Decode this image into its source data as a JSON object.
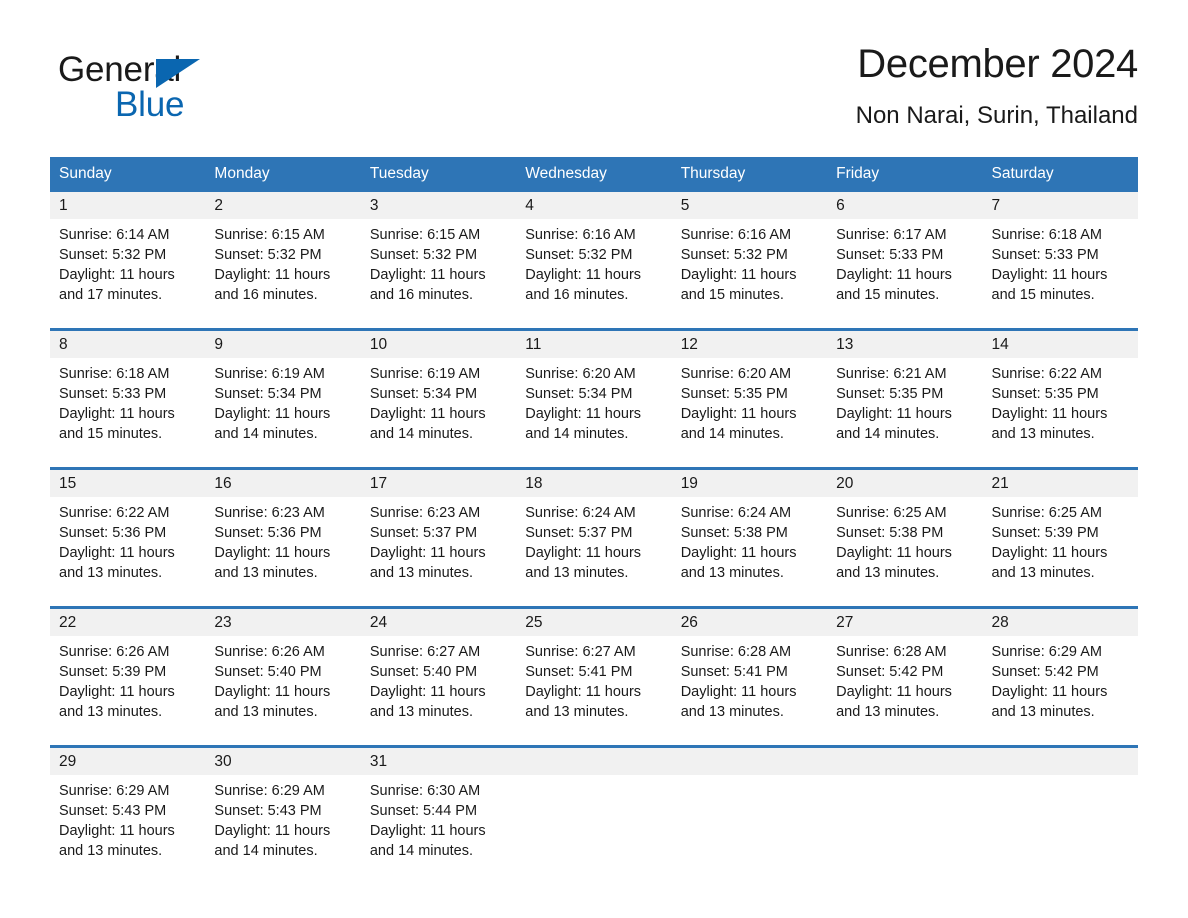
{
  "brand": {
    "logo_text_top": "General",
    "logo_text_bottom": "Blue",
    "triangle_color": "#0a66b0"
  },
  "header": {
    "title": "December 2024",
    "subtitle": "Non Narai, Surin, Thailand"
  },
  "theme": {
    "header_blue": "#2e75b6",
    "daynum_band": "#f1f1f1",
    "text": "#1a1a1a",
    "page_bg": "#ffffff"
  },
  "weekday_headers": [
    "Sunday",
    "Monday",
    "Tuesday",
    "Wednesday",
    "Thursday",
    "Friday",
    "Saturday"
  ],
  "weeks": [
    {
      "days": [
        {
          "num": "1",
          "sunrise": "Sunrise: 6:14 AM",
          "sunset": "Sunset: 5:32 PM",
          "daylight_1": "Daylight: 11 hours",
          "daylight_2": "and 17 minutes."
        },
        {
          "num": "2",
          "sunrise": "Sunrise: 6:15 AM",
          "sunset": "Sunset: 5:32 PM",
          "daylight_1": "Daylight: 11 hours",
          "daylight_2": "and 16 minutes."
        },
        {
          "num": "3",
          "sunrise": "Sunrise: 6:15 AM",
          "sunset": "Sunset: 5:32 PM",
          "daylight_1": "Daylight: 11 hours",
          "daylight_2": "and 16 minutes."
        },
        {
          "num": "4",
          "sunrise": "Sunrise: 6:16 AM",
          "sunset": "Sunset: 5:32 PM",
          "daylight_1": "Daylight: 11 hours",
          "daylight_2": "and 16 minutes."
        },
        {
          "num": "5",
          "sunrise": "Sunrise: 6:16 AM",
          "sunset": "Sunset: 5:32 PM",
          "daylight_1": "Daylight: 11 hours",
          "daylight_2": "and 15 minutes."
        },
        {
          "num": "6",
          "sunrise": "Sunrise: 6:17 AM",
          "sunset": "Sunset: 5:33 PM",
          "daylight_1": "Daylight: 11 hours",
          "daylight_2": "and 15 minutes."
        },
        {
          "num": "7",
          "sunrise": "Sunrise: 6:18 AM",
          "sunset": "Sunset: 5:33 PM",
          "daylight_1": "Daylight: 11 hours",
          "daylight_2": "and 15 minutes."
        }
      ]
    },
    {
      "days": [
        {
          "num": "8",
          "sunrise": "Sunrise: 6:18 AM",
          "sunset": "Sunset: 5:33 PM",
          "daylight_1": "Daylight: 11 hours",
          "daylight_2": "and 15 minutes."
        },
        {
          "num": "9",
          "sunrise": "Sunrise: 6:19 AM",
          "sunset": "Sunset: 5:34 PM",
          "daylight_1": "Daylight: 11 hours",
          "daylight_2": "and 14 minutes."
        },
        {
          "num": "10",
          "sunrise": "Sunrise: 6:19 AM",
          "sunset": "Sunset: 5:34 PM",
          "daylight_1": "Daylight: 11 hours",
          "daylight_2": "and 14 minutes."
        },
        {
          "num": "11",
          "sunrise": "Sunrise: 6:20 AM",
          "sunset": "Sunset: 5:34 PM",
          "daylight_1": "Daylight: 11 hours",
          "daylight_2": "and 14 minutes."
        },
        {
          "num": "12",
          "sunrise": "Sunrise: 6:20 AM",
          "sunset": "Sunset: 5:35 PM",
          "daylight_1": "Daylight: 11 hours",
          "daylight_2": "and 14 minutes."
        },
        {
          "num": "13",
          "sunrise": "Sunrise: 6:21 AM",
          "sunset": "Sunset: 5:35 PM",
          "daylight_1": "Daylight: 11 hours",
          "daylight_2": "and 14 minutes."
        },
        {
          "num": "14",
          "sunrise": "Sunrise: 6:22 AM",
          "sunset": "Sunset: 5:35 PM",
          "daylight_1": "Daylight: 11 hours",
          "daylight_2": "and 13 minutes."
        }
      ]
    },
    {
      "days": [
        {
          "num": "15",
          "sunrise": "Sunrise: 6:22 AM",
          "sunset": "Sunset: 5:36 PM",
          "daylight_1": "Daylight: 11 hours",
          "daylight_2": "and 13 minutes."
        },
        {
          "num": "16",
          "sunrise": "Sunrise: 6:23 AM",
          "sunset": "Sunset: 5:36 PM",
          "daylight_1": "Daylight: 11 hours",
          "daylight_2": "and 13 minutes."
        },
        {
          "num": "17",
          "sunrise": "Sunrise: 6:23 AM",
          "sunset": "Sunset: 5:37 PM",
          "daylight_1": "Daylight: 11 hours",
          "daylight_2": "and 13 minutes."
        },
        {
          "num": "18",
          "sunrise": "Sunrise: 6:24 AM",
          "sunset": "Sunset: 5:37 PM",
          "daylight_1": "Daylight: 11 hours",
          "daylight_2": "and 13 minutes."
        },
        {
          "num": "19",
          "sunrise": "Sunrise: 6:24 AM",
          "sunset": "Sunset: 5:38 PM",
          "daylight_1": "Daylight: 11 hours",
          "daylight_2": "and 13 minutes."
        },
        {
          "num": "20",
          "sunrise": "Sunrise: 6:25 AM",
          "sunset": "Sunset: 5:38 PM",
          "daylight_1": "Daylight: 11 hours",
          "daylight_2": "and 13 minutes."
        },
        {
          "num": "21",
          "sunrise": "Sunrise: 6:25 AM",
          "sunset": "Sunset: 5:39 PM",
          "daylight_1": "Daylight: 11 hours",
          "daylight_2": "and 13 minutes."
        }
      ]
    },
    {
      "days": [
        {
          "num": "22",
          "sunrise": "Sunrise: 6:26 AM",
          "sunset": "Sunset: 5:39 PM",
          "daylight_1": "Daylight: 11 hours",
          "daylight_2": "and 13 minutes."
        },
        {
          "num": "23",
          "sunrise": "Sunrise: 6:26 AM",
          "sunset": "Sunset: 5:40 PM",
          "daylight_1": "Daylight: 11 hours",
          "daylight_2": "and 13 minutes."
        },
        {
          "num": "24",
          "sunrise": "Sunrise: 6:27 AM",
          "sunset": "Sunset: 5:40 PM",
          "daylight_1": "Daylight: 11 hours",
          "daylight_2": "and 13 minutes."
        },
        {
          "num": "25",
          "sunrise": "Sunrise: 6:27 AM",
          "sunset": "Sunset: 5:41 PM",
          "daylight_1": "Daylight: 11 hours",
          "daylight_2": "and 13 minutes."
        },
        {
          "num": "26",
          "sunrise": "Sunrise: 6:28 AM",
          "sunset": "Sunset: 5:41 PM",
          "daylight_1": "Daylight: 11 hours",
          "daylight_2": "and 13 minutes."
        },
        {
          "num": "27",
          "sunrise": "Sunrise: 6:28 AM",
          "sunset": "Sunset: 5:42 PM",
          "daylight_1": "Daylight: 11 hours",
          "daylight_2": "and 13 minutes."
        },
        {
          "num": "28",
          "sunrise": "Sunrise: 6:29 AM",
          "sunset": "Sunset: 5:42 PM",
          "daylight_1": "Daylight: 11 hours",
          "daylight_2": "and 13 minutes."
        }
      ]
    },
    {
      "days": [
        {
          "num": "29",
          "sunrise": "Sunrise: 6:29 AM",
          "sunset": "Sunset: 5:43 PM",
          "daylight_1": "Daylight: 11 hours",
          "daylight_2": "and 13 minutes."
        },
        {
          "num": "30",
          "sunrise": "Sunrise: 6:29 AM",
          "sunset": "Sunset: 5:43 PM",
          "daylight_1": "Daylight: 11 hours",
          "daylight_2": "and 14 minutes."
        },
        {
          "num": "31",
          "sunrise": "Sunrise: 6:30 AM",
          "sunset": "Sunset: 5:44 PM",
          "daylight_1": "Daylight: 11 hours",
          "daylight_2": "and 14 minutes."
        },
        {
          "num": "",
          "sunrise": "",
          "sunset": "",
          "daylight_1": "",
          "daylight_2": ""
        },
        {
          "num": "",
          "sunrise": "",
          "sunset": "",
          "daylight_1": "",
          "daylight_2": ""
        },
        {
          "num": "",
          "sunrise": "",
          "sunset": "",
          "daylight_1": "",
          "daylight_2": ""
        },
        {
          "num": "",
          "sunrise": "",
          "sunset": "",
          "daylight_1": "",
          "daylight_2": ""
        }
      ]
    }
  ]
}
